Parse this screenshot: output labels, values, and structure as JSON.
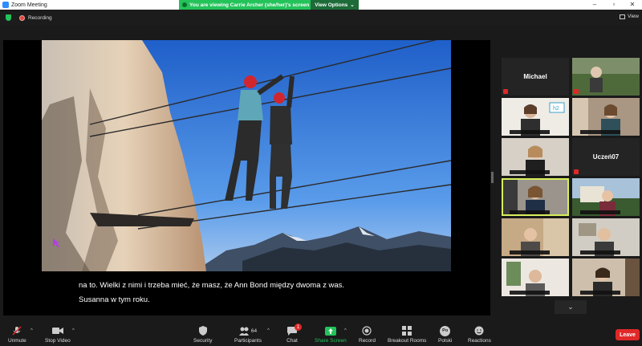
{
  "window": {
    "title": "Zoom Meeting"
  },
  "share_banner": {
    "message": "You are viewing Carrie Archer (she/her)'s screen",
    "options_label": "View Options"
  },
  "status": {
    "recording_label": "Recording",
    "view_label": "View"
  },
  "captions": {
    "line1": "na to. Wielki z nimi i trzeba mieć, że masz, że Ann Bond między dwoma z was.",
    "line2": "Susanna w tym roku."
  },
  "gallery": {
    "tiles": [
      {
        "name": "Michael"
      },
      {
        "name": ""
      },
      {
        "name": ""
      },
      {
        "name": ""
      },
      {
        "name": ""
      },
      {
        "name": "Uczeń07"
      },
      {
        "name": ""
      },
      {
        "name": ""
      },
      {
        "name": ""
      },
      {
        "name": ""
      },
      {
        "name": ""
      },
      {
        "name": ""
      }
    ]
  },
  "toolbar": {
    "unmute": "Unmute",
    "stop_video": "Stop Video",
    "security": "Security",
    "participants": "Participants",
    "participants_count": "64",
    "chat": "Chat",
    "chat_badge": "1",
    "share_screen": "Share Screen",
    "record": "Record",
    "breakout": "Breakout Rooms",
    "polski": "Polski",
    "polski_icon": "Po",
    "reactions": "Reactions",
    "leave": "Leave"
  },
  "colors": {
    "accent_green": "#23c35a",
    "leave_red": "#e02828",
    "active_speaker": "#d9ee5c"
  }
}
